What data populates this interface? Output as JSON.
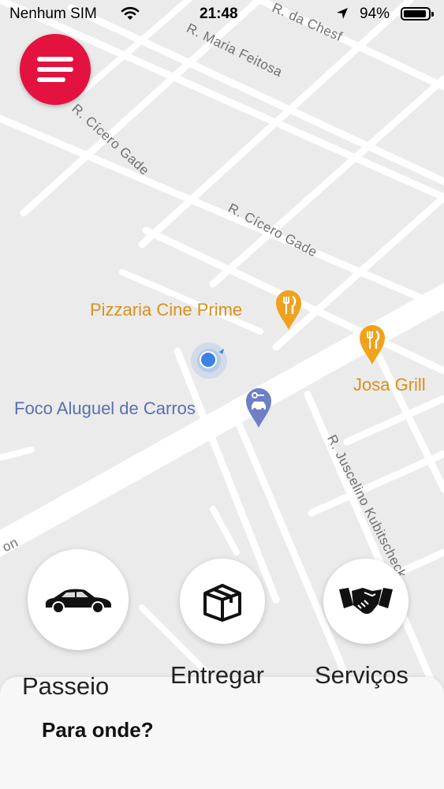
{
  "status_bar": {
    "carrier": "Nenhum SIM",
    "time": "21:48",
    "battery_percent": "94%",
    "battery_level": 0.94
  },
  "streets": {
    "da_chesf": "R. da Chesf",
    "maria_feitosa": "R. Maria Feitosa",
    "cicero_gade_1": "R. Cícero Gade",
    "cicero_gade_2": "R. Cícero Gade",
    "juscelino": "R. Juscelino Kubitscheck",
    "edge_fragment": "on"
  },
  "places": {
    "pizzaria": "Pizzaria Cine Prime",
    "josa": "Josa Grill",
    "foco": "Foco Aluguel de Carros"
  },
  "services": [
    {
      "label": "Passeio",
      "icon": "car-icon"
    },
    {
      "label": "Entregar",
      "icon": "package-icon"
    },
    {
      "label": "Serviços",
      "icon": "handshake-icon"
    }
  ],
  "bottom_sheet": {
    "prompt": "Para onde?"
  },
  "colors": {
    "menu_button": "#e4123f",
    "map_background": "#ebebeb",
    "poi_food": "#d9911b",
    "poi_service": "#5a6fb2",
    "user_location": "#3b82e8"
  }
}
